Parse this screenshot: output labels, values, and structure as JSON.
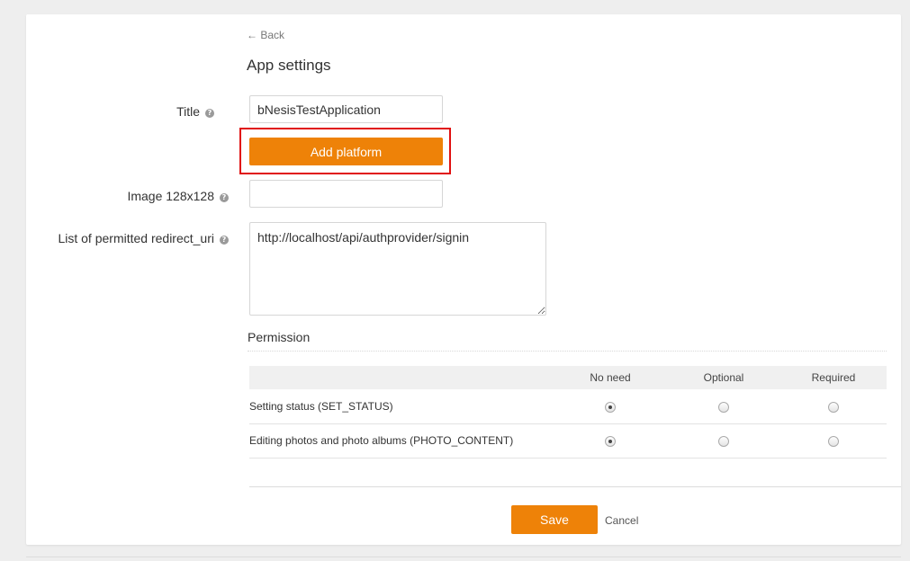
{
  "nav": {
    "back_label": "← Back"
  },
  "page": {
    "title": "App settings"
  },
  "form": {
    "title_label": "Title",
    "title_value": "bNesisTestApplication",
    "add_platform_label": "Add platform",
    "image_label": "Image 128x128",
    "image_value": "",
    "redirect_label": "List of permitted redirect_uri",
    "redirect_value": "http://localhost/api/authprovider/signin",
    "help_glyph": "?"
  },
  "permissions": {
    "title": "Permission",
    "columns": [
      "",
      "No need",
      "Optional",
      "Required"
    ],
    "rows": [
      {
        "label": "Setting status (SET_STATUS)",
        "selected": "No need"
      },
      {
        "label": "Editing photos and photo albums (PHOTO_CONTENT)",
        "selected": "No need"
      }
    ]
  },
  "footer": {
    "save_label": "Save",
    "cancel_label": "Cancel"
  },
  "colors": {
    "accent": "#ee8208",
    "highlight": "#e01010"
  }
}
